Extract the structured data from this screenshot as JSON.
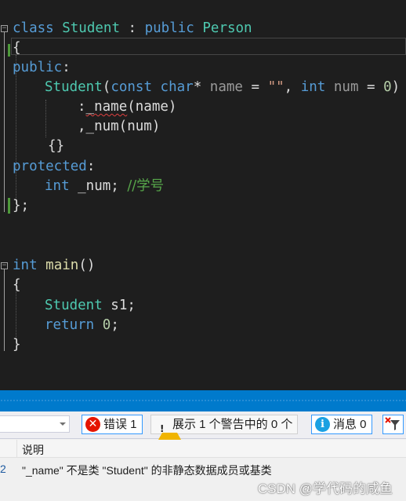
{
  "editor": {
    "lines": {
      "l1": {
        "kw1": "class",
        "name": "Student",
        "colon": " : ",
        "kw2": "public",
        "base": "Person"
      },
      "l2": {
        "text": "{"
      },
      "l3": {
        "kw": "public",
        "colon": ":"
      },
      "l4": {
        "fn": "Student",
        "open": "(",
        "kw1": "const",
        "kw2": "char",
        "star": "*",
        "p1": "name",
        "eq": " = ",
        "str": "\"\"",
        "comma": ", ",
        "kw3": "int",
        "p2": "num",
        "eq2": " = ",
        "val": "0",
        "close": ")"
      },
      "l5": {
        "colon": ":",
        "member": "_name",
        "arg": "(name)"
      },
      "l6": {
        "text": ",_num(num)"
      },
      "l7": {
        "text": "{}"
      },
      "l8": {
        "kw": "protected",
        "colon": ":"
      },
      "l9": {
        "kw": "int",
        "var": " _num; ",
        "comment": "//学号"
      },
      "l10": {
        "text": "};"
      },
      "l11": {
        "kw": "int",
        "fn": "main",
        "paren": "()"
      },
      "l12": {
        "text": "{"
      },
      "l13": {
        "ty": "Student",
        "rest": " s1;"
      },
      "l14": {
        "kw": "return",
        "sp": " ",
        "val": "0",
        "semi": ";"
      },
      "l15": {
        "text": "}"
      }
    }
  },
  "error_list": {
    "errors_label": "错误 1",
    "warnings_label": "展示 1 个警告中的 0 个",
    "messages_label": "消息 0",
    "column_description": "说明",
    "rows": [
      {
        "line_num": "2",
        "description": "\"_name\" 不是类 \"Student\" 的非静态数据成员或基类"
      }
    ]
  },
  "watermark": "CSDN @学代码的咸鱼",
  "colors": {
    "keyword": "#569cd6",
    "type": "#4ec9b0",
    "function": "#dcdcaa",
    "comment": "#57a64a",
    "error": "#e51400"
  }
}
